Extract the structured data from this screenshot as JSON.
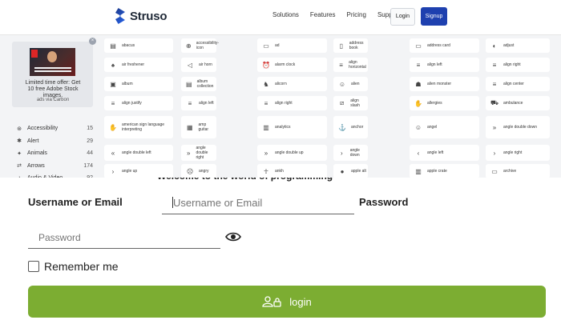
{
  "header": {
    "brand": "Struso",
    "nav": [
      "Solutions",
      "Features",
      "Pricing",
      "Support"
    ],
    "login_label": "Login",
    "signup_label": "Signup",
    "accent_color": "#1e40af"
  },
  "ad": {
    "text": "Limited time offer: Get 10 free Adobe Stock images.",
    "via": "ads via Carbon",
    "close_symbol": "×"
  },
  "sidebar": {
    "items": [
      {
        "label": "Accessibility",
        "count": "15",
        "icon": "accessibility-icon"
      },
      {
        "label": "Alert",
        "count": "29",
        "icon": "alert-icon"
      },
      {
        "label": "Animals",
        "count": "44",
        "icon": "animals-icon"
      },
      {
        "label": "Arrows",
        "count": "174",
        "icon": "arrows-icon"
      },
      {
        "label": "Audio & Video",
        "count": "92",
        "icon": "audio-video-icon"
      }
    ]
  },
  "icon_grid": {
    "tiles": [
      {
        "label": "abacus",
        "glyph": "▤"
      },
      {
        "label": "accessibility-icon",
        "glyph": "⊕"
      },
      {
        "label": "ad",
        "glyph": "▭"
      },
      {
        "label": "address book",
        "glyph": "▯"
      },
      {
        "label": "address card",
        "glyph": "▭"
      },
      {
        "label": "adjust",
        "glyph": "◐"
      },
      {
        "label": "air freshener",
        "glyph": "♠"
      },
      {
        "label": "air horn",
        "glyph": "◁"
      },
      {
        "label": "alarm clock",
        "glyph": "⏰"
      },
      {
        "label": "align horizontal",
        "glyph": "≡"
      },
      {
        "label": "align left",
        "glyph": "≡"
      },
      {
        "label": "align right",
        "glyph": "≡"
      },
      {
        "label": "album",
        "glyph": "▣"
      },
      {
        "label": "album collection",
        "glyph": "▤"
      },
      {
        "label": "alicorn",
        "glyph": "♞"
      },
      {
        "label": "alien",
        "glyph": "☺"
      },
      {
        "label": "alien monster",
        "glyph": "☗"
      },
      {
        "label": "align center",
        "glyph": "≡"
      },
      {
        "label": "align justify",
        "glyph": "≡"
      },
      {
        "label": "align left",
        "glyph": "≡"
      },
      {
        "label": "align right",
        "glyph": "≡"
      },
      {
        "label": "align slash",
        "glyph": "⧄"
      },
      {
        "label": "allergies",
        "glyph": "✋"
      },
      {
        "label": "ambulance",
        "glyph": "⛟"
      },
      {
        "label": "american sign language interpreting",
        "glyph": "✋"
      },
      {
        "label": "amp guitar",
        "glyph": "▦"
      },
      {
        "label": "analytics",
        "glyph": "▥"
      },
      {
        "label": "anchor",
        "glyph": "⚓"
      },
      {
        "label": "angel",
        "glyph": "☺"
      },
      {
        "label": "angle double down",
        "glyph": "»"
      },
      {
        "label": "angle double left",
        "glyph": "«"
      },
      {
        "label": "angle double right",
        "glyph": "»"
      },
      {
        "label": "angle double up",
        "glyph": "»"
      },
      {
        "label": "angle down",
        "glyph": "›"
      },
      {
        "label": "angle left",
        "glyph": "‹"
      },
      {
        "label": "angle right",
        "glyph": "›"
      },
      {
        "label": "angle up",
        "glyph": "›"
      },
      {
        "label": "angry",
        "glyph": "☹"
      },
      {
        "label": "ankh",
        "glyph": "☥"
      },
      {
        "label": "apple alt",
        "glyph": "●"
      },
      {
        "label": "apple crate",
        "glyph": "▥"
      },
      {
        "label": "archive",
        "glyph": "▭"
      }
    ]
  },
  "form": {
    "title": "Welcome to the world of programming",
    "username_label": "Username or Email",
    "username_placeholder": "Username or Email",
    "password_label": "Password",
    "password_placeholder": "Password",
    "remember_label": "Remember me",
    "submit_label": "login",
    "submit_color": "#7cad32"
  }
}
